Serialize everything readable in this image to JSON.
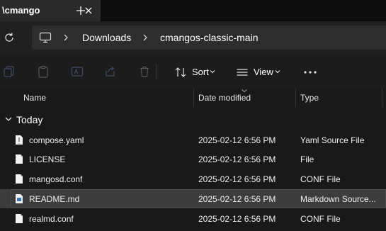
{
  "window": {
    "tab_title": "\\cmango",
    "close_icon": "close-icon",
    "new_tab_icon": "plus-icon"
  },
  "address": {
    "refresh_icon": "refresh-icon",
    "computer_icon": "monitor-icon",
    "breadcrumbs": [
      "Downloads",
      "cmangos-classic-main"
    ]
  },
  "toolbar": {
    "icons": [
      "copy-icon",
      "paste-icon",
      "rename-icon",
      "share-icon",
      "delete-icon"
    ],
    "sort_label": "Sort",
    "view_label": "View",
    "more_icon": "more-icon"
  },
  "columns": {
    "name": "Name",
    "date": "Date modified",
    "type": "Type"
  },
  "group": {
    "label": "Today"
  },
  "files": [
    {
      "name": "compose.yaml",
      "date": "2025-02-12 6:56 PM",
      "type": "Yaml Source File",
      "icon": "yaml-file-icon"
    },
    {
      "name": "LICENSE",
      "date": "2025-02-12 6:56 PM",
      "type": "File",
      "icon": "file-icon"
    },
    {
      "name": "mangosd.conf",
      "date": "2025-02-12 6:56 PM",
      "type": "CONF File",
      "icon": "file-icon"
    },
    {
      "name": "README.md",
      "date": "2025-02-12 6:56 PM",
      "type": "Markdown Source...",
      "icon": "markdown-file-icon",
      "selected": true
    },
    {
      "name": "realmd.conf",
      "date": "2025-02-12 6:56 PM",
      "type": "CONF File",
      "icon": "file-icon"
    }
  ]
}
